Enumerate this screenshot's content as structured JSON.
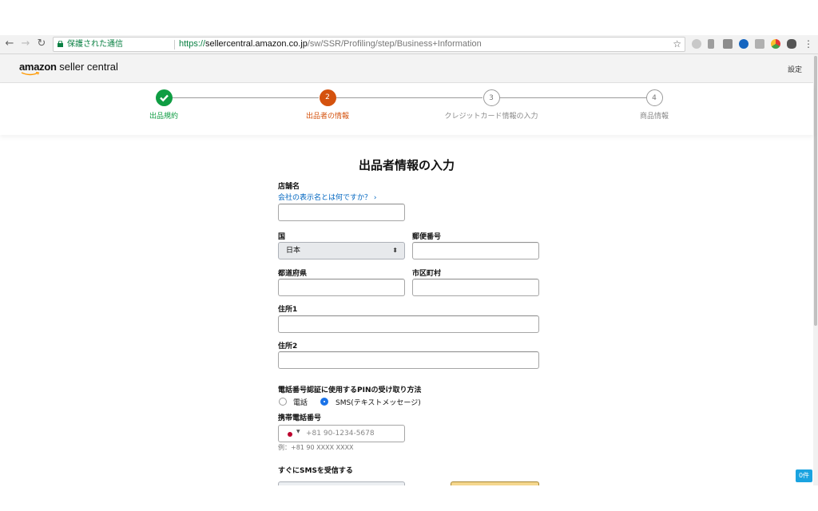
{
  "browser": {
    "secure_label": "保護された通信",
    "url_scheme": "https://",
    "url_host": "sellercentral.amazon.co.jp",
    "url_path": "/sw/SSR/Profiling/step/Business+Information"
  },
  "header": {
    "logo_amazon": "amazon",
    "logo_rest": " seller central",
    "settings_label": "設定"
  },
  "steps": [
    {
      "number": "",
      "label": "出品規約",
      "state": "done"
    },
    {
      "number": "2",
      "label": "出品者の情報",
      "state": "active"
    },
    {
      "number": "3",
      "label": "クレジットカード情報の入力",
      "state": "todo"
    },
    {
      "number": "4",
      "label": "商品情報",
      "state": "todo"
    }
  ],
  "form": {
    "title": "出品者情報の入力",
    "store_name_label": "店舗名",
    "store_name_help_link": "会社の表示名とは何ですか？ ›",
    "store_name_value": "",
    "country_label": "国",
    "country_value": "日本",
    "postal_label": "郵便番号",
    "postal_value": "",
    "prefecture_label": "都道府県",
    "prefecture_value": "",
    "city_label": "市区町村",
    "city_value": "",
    "address1_label": "住所1",
    "address1_value": "",
    "address2_label": "住所2",
    "address2_value": "",
    "pin_method_label": "電話番号認証に使用するPINの受け取り方法",
    "pin_option_phone": "電話",
    "pin_option_sms": "SMS(テキストメッセージ)",
    "pin_selected": "SMS(テキストメッセージ)",
    "mobile_label": "携帯電話番号",
    "mobile_placeholder": "+81 90-1234-5678",
    "mobile_hint": "例：+81 90 XXXX XXXX",
    "receive_sms_label": "すぐにSMSを受信する"
  },
  "badge": {
    "count_label": "0件"
  },
  "colors": {
    "step_done": "#0f9d43",
    "step_active": "#d4520e",
    "link": "#0066c0",
    "radio_selected": "#1a73e8",
    "badge": "#1aa3e0"
  }
}
